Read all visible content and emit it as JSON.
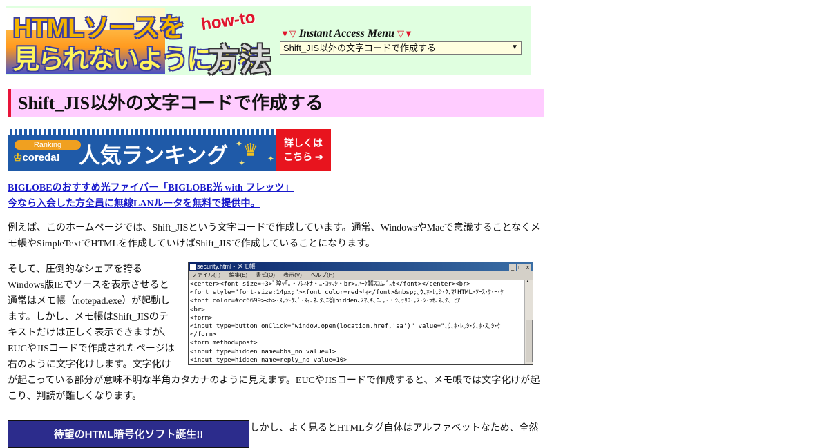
{
  "header": {
    "logo_line1": "HTMLソースを",
    "logo_line2": "見られないようにする",
    "logo_howto": "how-to",
    "logo_houho": "方法",
    "menu_title": "Instant Access Menu",
    "menu_selected": "Shift_JIS以外の文字コードで作成する"
  },
  "page_title": "Shift_JIS以外の文字コードで作成する",
  "banner": {
    "pill": "Ranking",
    "brand": "coreda!",
    "headline": "人気ランキング",
    "detail_line1": "詳しくは",
    "detail_line2": "こちら ➔"
  },
  "ad_links": [
    "BIGLOBEのおすすめ光ファイバー「BIGLOBE光 with フレッツ」",
    "今なら入会した方全員に無線LANルータを無料で提供中。"
  ],
  "paragraph1": "例えば、このホームページでは、Shift_JISという文字コードで作成しています。通常、WindowsやMacで意識することなくメモ帳やSimpleTextでHTMLを作成していけばShift_JISで作成していることになります。",
  "paragraph2_left": "そして、圧倒的なシェアを誇るWindows版IEでソースを表示させると通常はメモ帳（notepad.exe）が起動します。しかし、メモ帳はShift_JISのテキストだけは正しく表示できますが、EUCやJISコードで作成されたページは右のように文字化けします。文字化け",
  "paragraph2_tail": "が起こっている部分が意味不明な半角カタカナのように見えます。EUCやJISコードで作成すると、メモ帳では文字化けが起こり、判読が難しくなります。",
  "notepad": {
    "title": "security.html - メモ帳",
    "menu": [
      "ファイル(F)",
      "編集(E)",
      "書式(O)",
      "表示(V)",
      "ヘルプ(H)"
    ],
    "lines": [
      "<center><font size=+3>ﾞ隍ｯ｢｡・ｿｼﾈﾄﾅ・ﾆ･ｺｳ｡ｼ・br>｡ﾊｰｹ蠶ｽｺﾑ｡ﾞ｡ｾ</font></center><br>",
      "<font style=\"font-size:14px;\"><font color=red>｢ｨ</font>&nbsp;｡ｳ､ﾎ･ﾚ｡ｼ･ｸ､ﾏ｢HTML･ｿｰｽ･ｹ･ｰ･ｹ",
      "<font color=#cc6699><b>･ｽ｡ｼ･ｹ､ﾟ･ｽｨ､ﾈ､ﾀ､ﾆ箚hidden､ｽﾏ､ｷ､ﾆ､｡･・ｼ､ｯﾘｺ･｡ｽ･ｼ･ﾗｾ､ﾏ､ｸ､ｰﾋｱ",
      "<br>",
      "<form>",
      "<input type=button onClick=\"window.open(location.href,'sa')\" value=\"､ｳ､ﾎ･ﾚ｡ｼ･ｸ､ﾎ･ｽ｡ｼ･ｹ",
      "</form>",
      "<form method=post>",
      "<input type=hidden name=bbs_no value=1>",
      "<input type=hidden name=reply_no value=10>"
    ]
  },
  "bottom_ad": "待望のHTML暗号化ソフト誕生!!",
  "bottom_text": "しかし、よく見るとHTMLタグ自体はアルファベットなため、全然"
}
